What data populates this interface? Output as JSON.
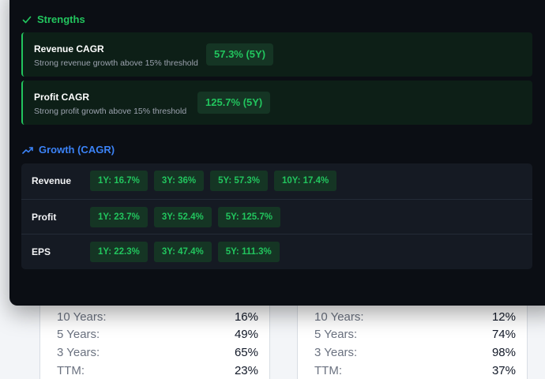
{
  "background_tables": {
    "left": {
      "rows": [
        {
          "label": "10 Years:",
          "value": "16%"
        },
        {
          "label": "5 Years:",
          "value": "49%"
        },
        {
          "label": "3 Years:",
          "value": "65%"
        },
        {
          "label": "TTM:",
          "value": "23%"
        }
      ]
    },
    "right": {
      "rows": [
        {
          "label": "10 Years:",
          "value": "12%"
        },
        {
          "label": "5 Years:",
          "value": "74%"
        },
        {
          "label": "3 Years:",
          "value": "98%"
        },
        {
          "label": "TTM:",
          "value": "37%"
        }
      ]
    }
  },
  "strengths": {
    "title": "Strengths",
    "icon": "check-icon",
    "cards": [
      {
        "title": "Revenue CAGR",
        "description": "Strong revenue growth above 15% threshold",
        "badge": "57.3% (5Y)"
      },
      {
        "title": "Profit CAGR",
        "description": "Strong profit growth above 15% threshold",
        "badge": "125.7% (5Y)"
      }
    ]
  },
  "growth": {
    "title": "Growth (CAGR)",
    "icon": "trending-up-icon",
    "rows": [
      {
        "label": "Revenue",
        "chips": [
          "1Y: 16.7%",
          "3Y: 36%",
          "5Y: 57.3%",
          "10Y: 17.4%"
        ]
      },
      {
        "label": "Profit",
        "chips": [
          "1Y: 23.7%",
          "3Y: 52.4%",
          "5Y: 125.7%"
        ]
      },
      {
        "label": "EPS",
        "chips": [
          "1Y: 22.3%",
          "3Y: 47.4%",
          "5Y: 111.3%"
        ]
      }
    ]
  },
  "colors": {
    "panel_bg": "#0b0e14",
    "accent_green": "#22c55e",
    "accent_blue": "#3b82f6",
    "chip_bg": "#153524"
  }
}
